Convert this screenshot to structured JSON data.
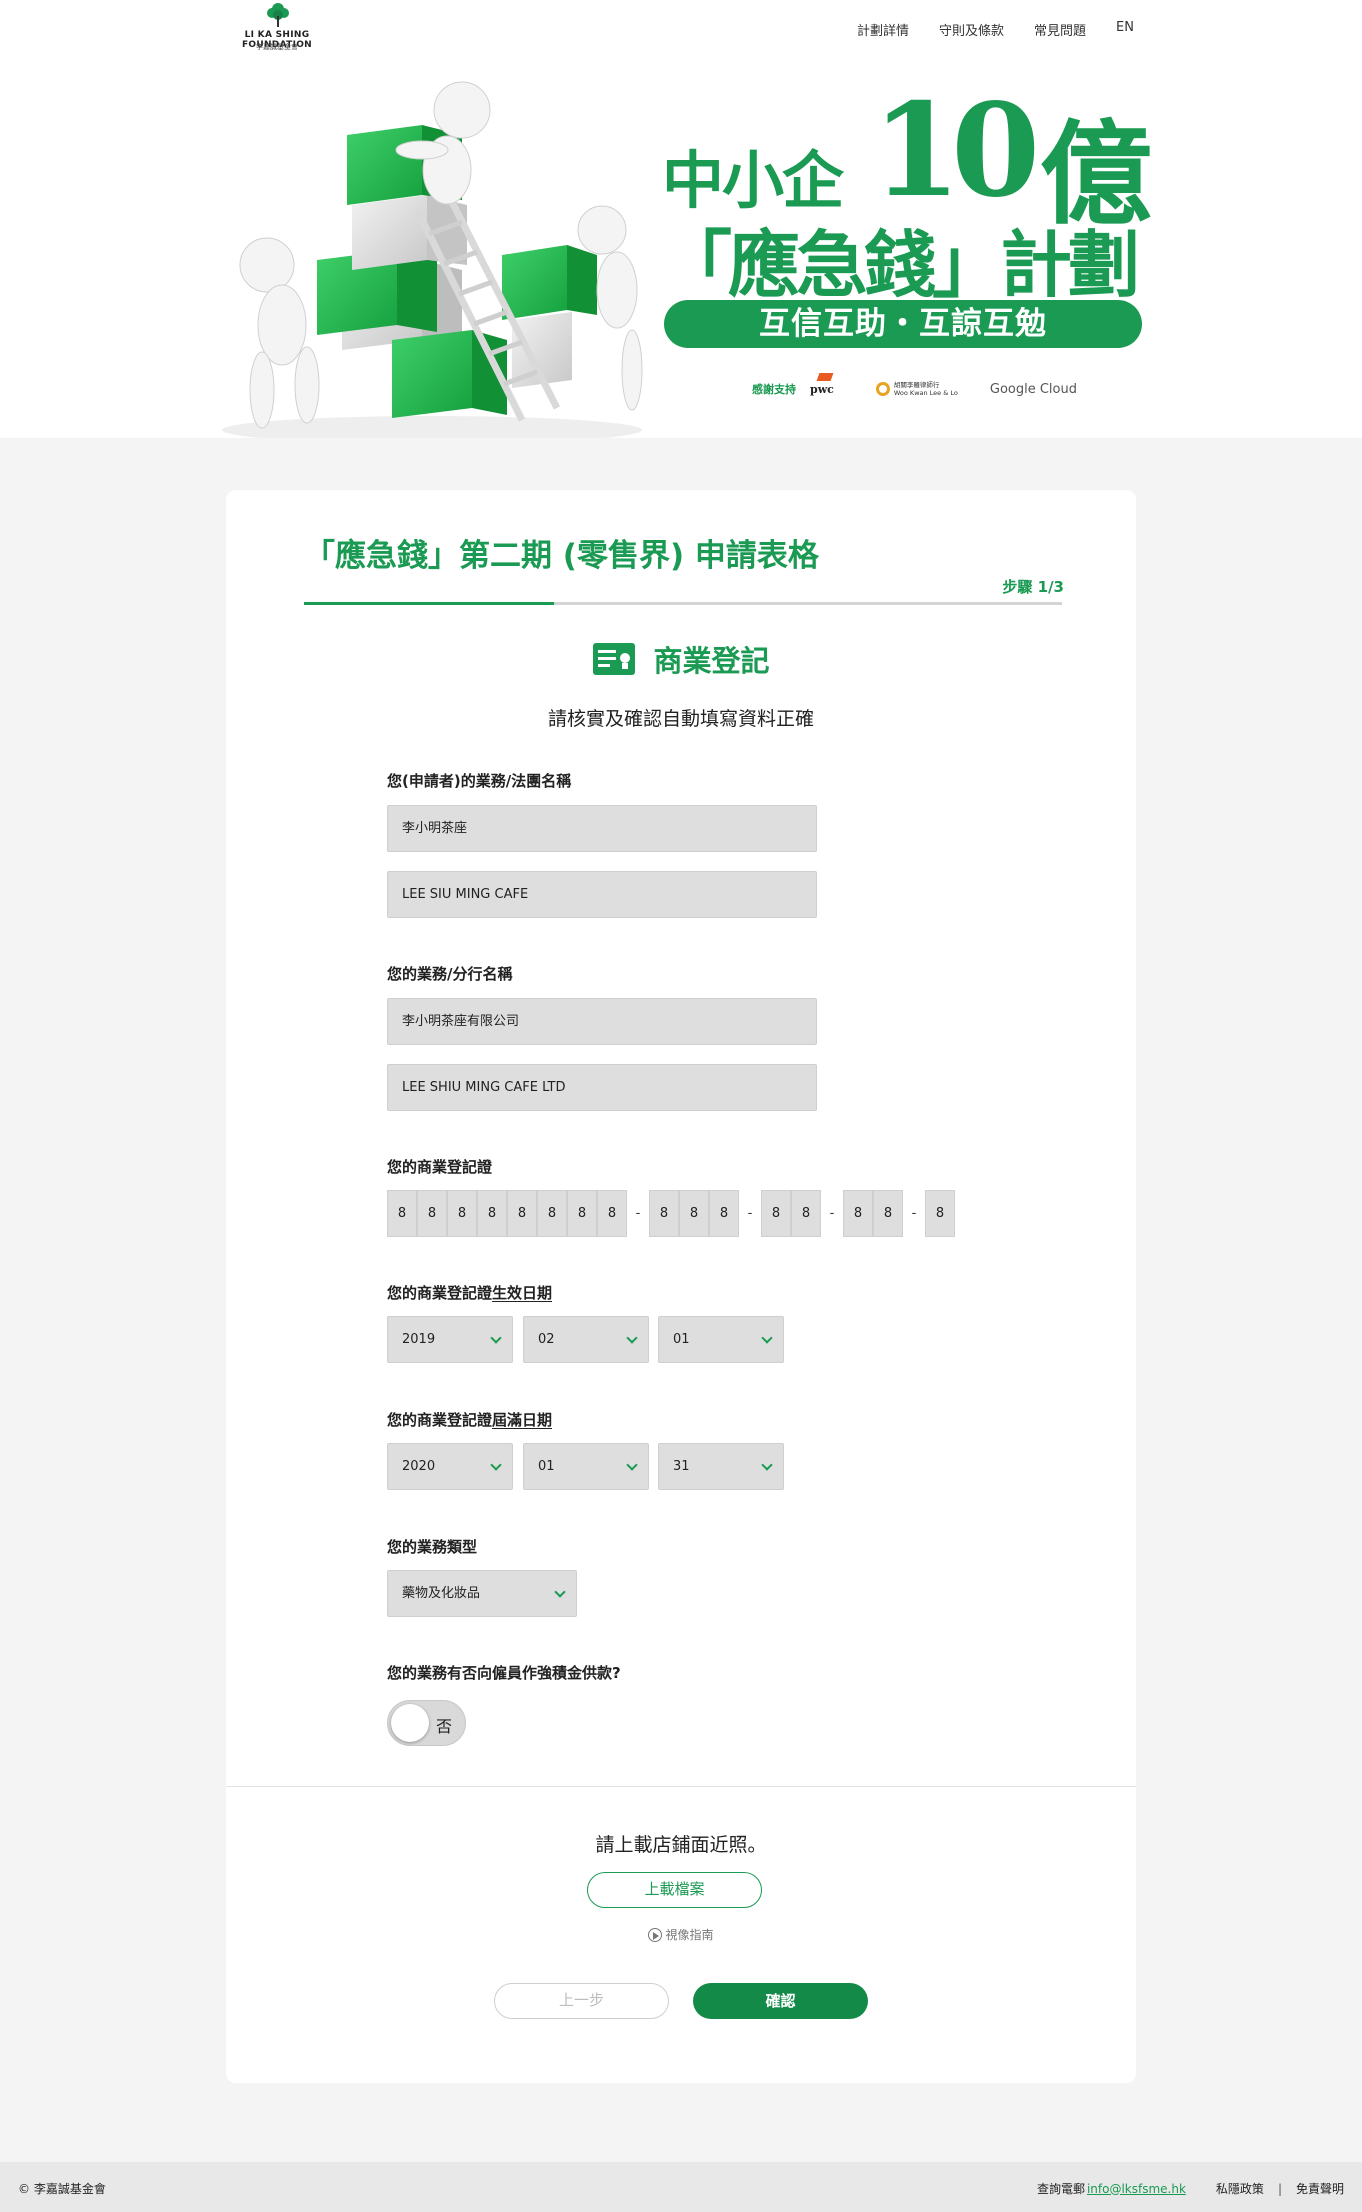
{
  "header": {
    "logo_en": "LI KA SHING FOUNDATION",
    "logo_zh": "李嘉誠基金會",
    "nav": [
      "計劃詳情",
      "守則及條款",
      "常見問題",
      "EN"
    ]
  },
  "hero": {
    "title_small": "中小企",
    "title_number": "10",
    "title_unit": "億",
    "title_line2": "「應急錢」計劃",
    "slogan": "互信互助・互諒互勉",
    "sponsors_label": "感謝支持",
    "sponsor_pwc": "pwc",
    "sponsor_wkll_zh": "胡關李羅律師行",
    "sponsor_wkll_en": "Woo Kwan Lee & Lo",
    "sponsor_google": "Google Cloud"
  },
  "form": {
    "title": "「應急錢」第二期 (零售界) 申請表格",
    "step": "步驟 1/3",
    "progress": 0.33,
    "section_title": "商業登記",
    "section_subtitle": "請核實及確認自動填寫資料正確",
    "legal_name_label": "您(申請者)的業務/法團名稱",
    "legal_name_zh": "李小明茶座",
    "legal_name_en": "LEE SIU MING CAFE",
    "branch_name_label": "您的業務/分行名稱",
    "branch_name_zh": "李小明茶座有限公司",
    "branch_name_en": "LEE SHIU MING CAFE LTD",
    "brn_label": "您的商業登記證",
    "brn_groups": [
      [
        "8",
        "8",
        "8",
        "8",
        "8",
        "8",
        "8",
        "8"
      ],
      [
        "8",
        "8",
        "8"
      ],
      [
        "8",
        "8"
      ],
      [
        "8",
        "8"
      ],
      [
        "8"
      ]
    ],
    "brn_separator": "-",
    "effective_label_prefix": "您的商業登記證",
    "effective_label_emph": "生效日期",
    "effective_year": "2019",
    "effective_month": "02",
    "effective_day": "01",
    "expiry_label_prefix": "您的商業登記證",
    "expiry_label_emph": "屆滿日期",
    "expiry_year": "2020",
    "expiry_month": "01",
    "expiry_day": "31",
    "business_type_label": "您的業務類型",
    "business_type_value": "藥物及化妝品",
    "mpf_label": "您的業務有否向僱員作強積金供款?",
    "mpf_value": "否",
    "upload_prompt": "請上載店鋪面近照。",
    "upload_button": "上載檔案",
    "video_guide": "視像指南",
    "prev_button": "上一步",
    "confirm_button": "確認"
  },
  "footer": {
    "copyright": "© 李嘉誠基金會",
    "enquiry_label": "查詢電郵",
    "email": "info@lksfsme.hk",
    "privacy": "私隱政策",
    "separator": "|",
    "disclaimer": "免責聲明"
  },
  "colors": {
    "brand_green": "#1a9a52",
    "button_green": "#148a48",
    "field_bg": "#dedede",
    "page_bg": "#f4f4f4"
  }
}
